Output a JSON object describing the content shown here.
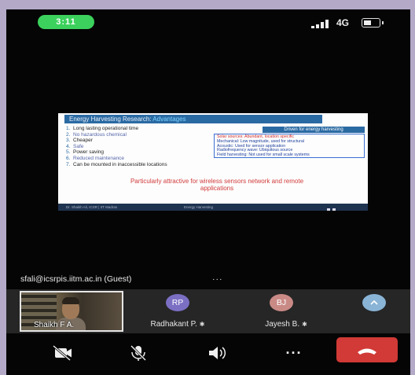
{
  "status_bar": {
    "time": "3:11",
    "network": "4G",
    "battery_level": 0.5
  },
  "slide": {
    "title_main": "Energy Harvesting Research: ",
    "title_accent": "Advantages",
    "bullets": [
      "Long lasting operational time",
      "No hazardous chemical",
      "Cheaper",
      "Safe",
      "Power saving",
      "Reduced maintenance",
      "Can be mounted in inaccessible locations"
    ],
    "driver_heading": "Driven for energy harvesting",
    "drivers": [
      "Solar sources: Abundant, location specific",
      "Mechanical: Low magnitude, used for structural",
      "Acoustic: Used for sensor application",
      "Radiofrequency wave: Ubiquitous source",
      "Field harvesting: Not used for small scale systems"
    ],
    "attraction_line1": "Particularly attractive for wireless sensors network and remote",
    "attraction_line2": "applications",
    "footer_left": "Dr. Shaikh Ali, ICSR | IIT Madras",
    "footer_middle": "Energy Harvesting"
  },
  "guest": {
    "label": "sfali@icsrpis.iitm.ac.in (Guest)",
    "more": "···"
  },
  "participants": [
    {
      "name": "Shaikh F A.",
      "type": "video"
    },
    {
      "name": "Radhakant P.",
      "initials": "RP",
      "color": "#7b6fc4",
      "muted": true
    },
    {
      "name": "Jayesh B.",
      "initials": "BJ",
      "color": "#c98a86",
      "muted": true
    },
    {
      "name": "",
      "initials": "^",
      "color": "#89b4d6"
    }
  ],
  "controls": {
    "mic_muted_glyph": "✱",
    "more_dots": "···"
  }
}
